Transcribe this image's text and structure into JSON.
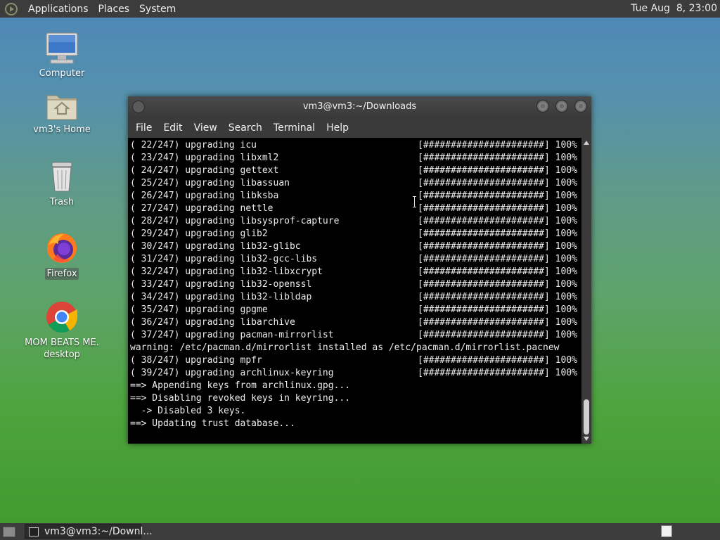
{
  "top_panel": {
    "menus": [
      "Applications",
      "Places",
      "System"
    ],
    "clock": "Tue Aug  8, 23:00"
  },
  "desktop_icons": [
    {
      "label": "Computer",
      "icon": "computer-icon"
    },
    {
      "label": "vm3's Home",
      "icon": "home-folder-icon"
    },
    {
      "label": "Trash",
      "icon": "trash-icon"
    },
    {
      "label": "Firefox",
      "icon": "firefox-icon"
    },
    {
      "label": "MOM BEATS ME.\ndesktop",
      "icon": "chrome-icon"
    }
  ],
  "terminal": {
    "title": "vm3@vm3:~/Downloads",
    "menu": [
      "File",
      "Edit",
      "View",
      "Search",
      "Terminal",
      "Help"
    ],
    "progress_bar": "[######################]",
    "lines": [
      {
        "text": "( 22/247) upgrading icu",
        "pct": "100%"
      },
      {
        "text": "( 23/247) upgrading libxml2",
        "pct": "100%"
      },
      {
        "text": "( 24/247) upgrading gettext",
        "pct": "100%"
      },
      {
        "text": "( 25/247) upgrading libassuan",
        "pct": "100%"
      },
      {
        "text": "( 26/247) upgrading libksba",
        "pct": "100%"
      },
      {
        "text": "( 27/247) upgrading nettle",
        "pct": "100%"
      },
      {
        "text": "( 28/247) upgrading libsysprof-capture",
        "pct": "100%"
      },
      {
        "text": "( 29/247) upgrading glib2",
        "pct": "100%"
      },
      {
        "text": "( 30/247) upgrading lib32-glibc",
        "pct": "100%"
      },
      {
        "text": "( 31/247) upgrading lib32-gcc-libs",
        "pct": "100%"
      },
      {
        "text": "( 32/247) upgrading lib32-libxcrypt",
        "pct": "100%"
      },
      {
        "text": "( 33/247) upgrading lib32-openssl",
        "pct": "100%"
      },
      {
        "text": "( 34/247) upgrading lib32-libldap",
        "pct": "100%"
      },
      {
        "text": "( 35/247) upgrading gpgme",
        "pct": "100%"
      },
      {
        "text": "( 36/247) upgrading libarchive",
        "pct": "100%"
      },
      {
        "text": "( 37/247) upgrading pacman-mirrorlist",
        "pct": "100%"
      },
      {
        "text": "warning: /etc/pacman.d/mirrorlist installed as /etc/pacman.d/mirrorlist.pacnew",
        "pct": ""
      },
      {
        "text": "( 38/247) upgrading mpfr",
        "pct": "100%"
      },
      {
        "text": "( 39/247) upgrading archlinux-keyring",
        "pct": "100%"
      },
      {
        "text": "==> Appending keys from archlinux.gpg...",
        "pct": ""
      },
      {
        "text": "==> Disabling revoked keys in keyring...",
        "pct": ""
      },
      {
        "text": "  -> Disabled 3 keys.",
        "pct": ""
      },
      {
        "text": "==> Updating trust database...",
        "pct": ""
      }
    ]
  },
  "taskbar": {
    "task_label": "vm3@vm3:~/Downl..."
  }
}
